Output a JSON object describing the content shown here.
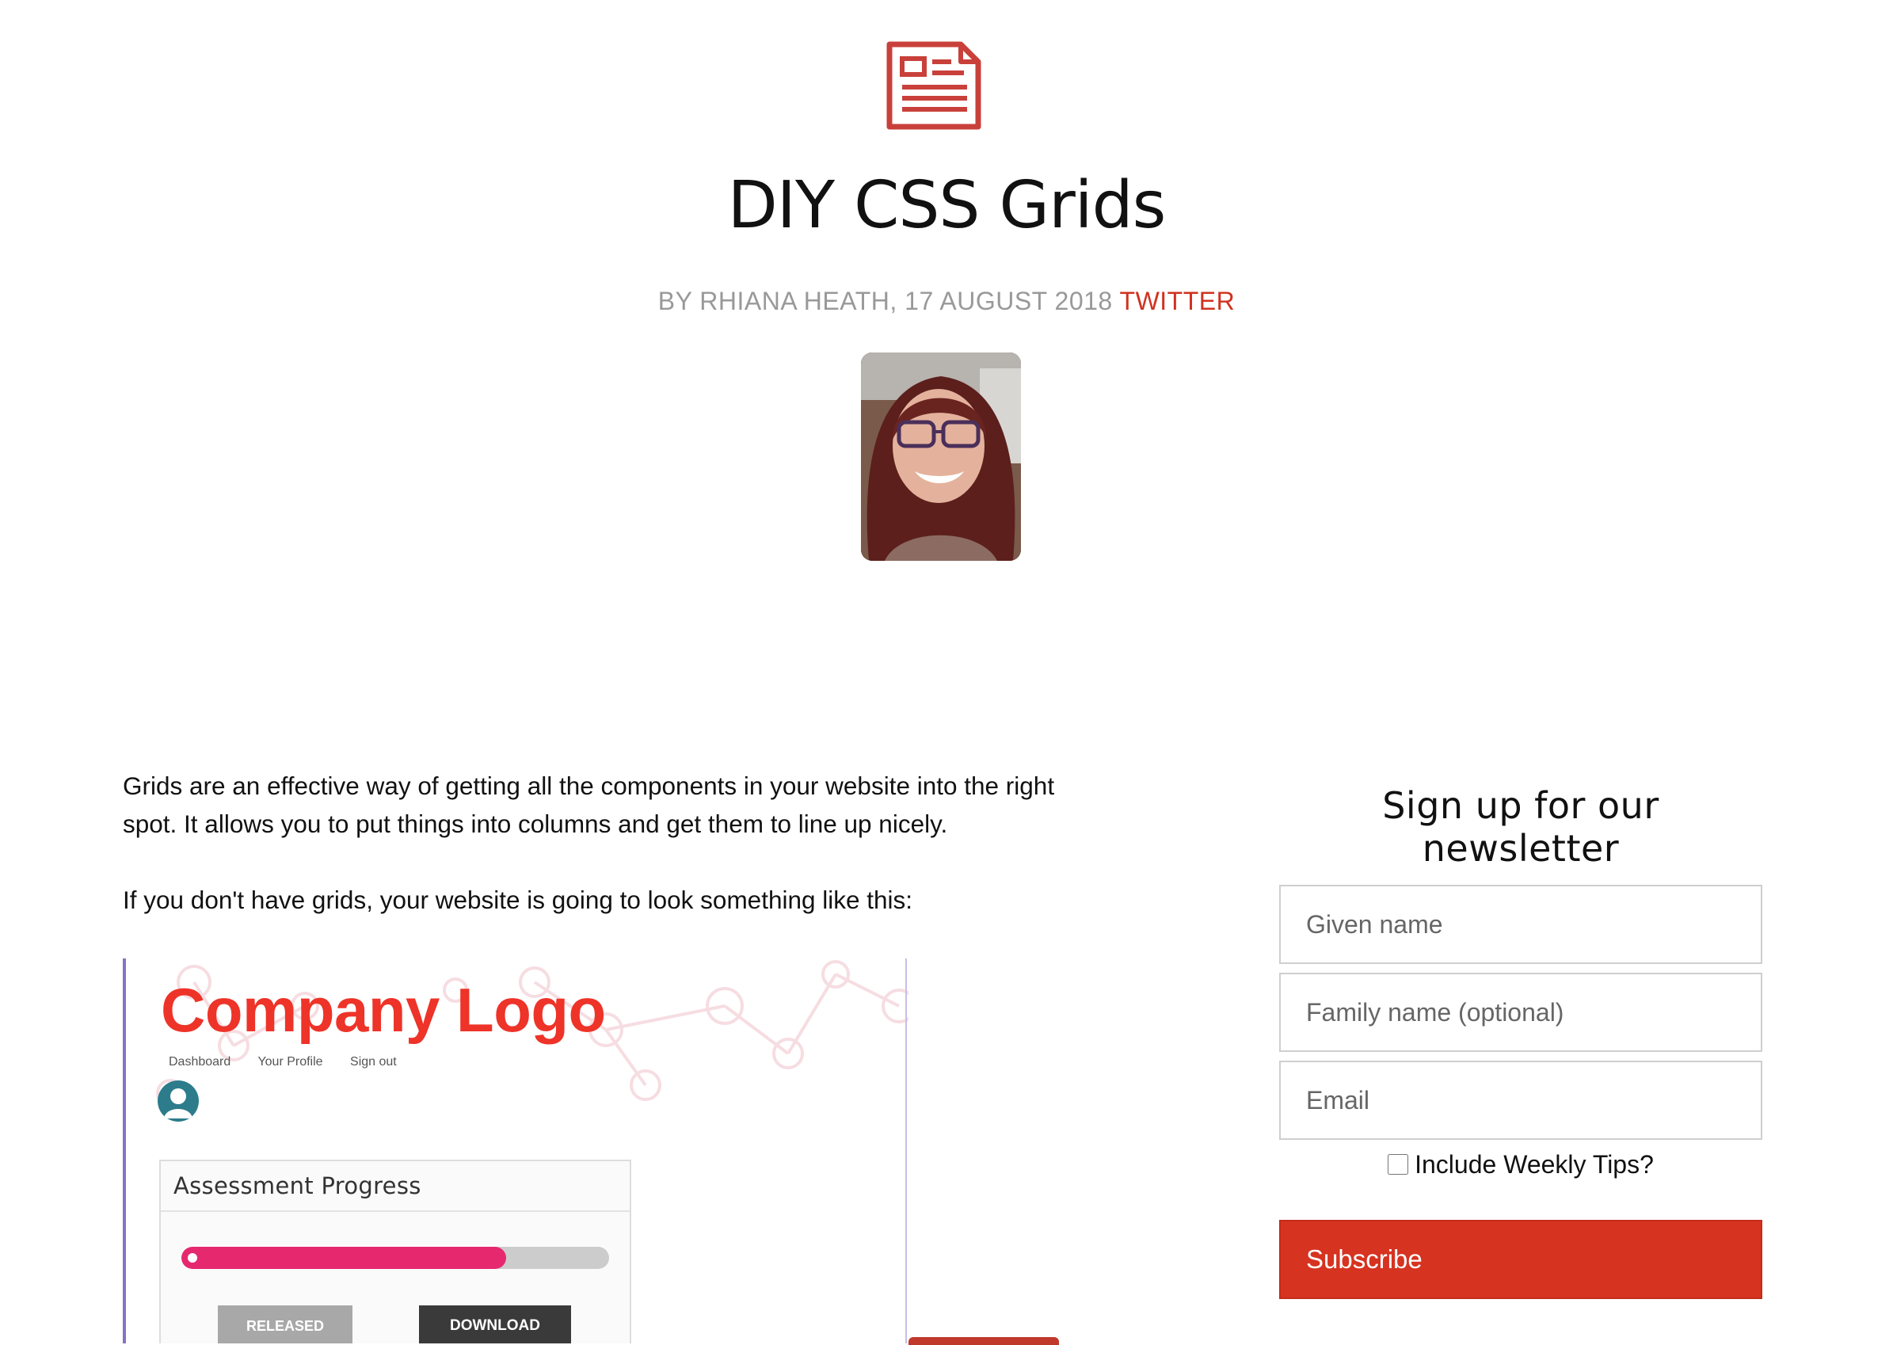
{
  "article": {
    "title": "DIY CSS Grids",
    "byline": "BY RHIANA HEATH, 17 AUGUST 2018",
    "twitter_label": "TWITTER",
    "paragraph_1": "Grids are an effective way of getting all the components in your website into the right spot. It allows you to put things into columns and get them to line up nicely.",
    "paragraph_2": "If you don't have grids, your website is going to look something like this:"
  },
  "figure": {
    "logo_text": "Company Logo",
    "nav": [
      "Dashboard",
      "Your Profile",
      "Sign out"
    ],
    "card_title": "Assessment Progress",
    "progress": 0.76,
    "released_label": "RELEASED",
    "download_label": "DOWNLOAD"
  },
  "newsletter": {
    "heading": "Sign up for our newsletter",
    "given_name_placeholder": "Given name",
    "family_name_placeholder": "Family name (optional)",
    "email_placeholder": "Email",
    "tips_label": "Include Weekly Tips?",
    "subscribe_label": "Subscribe"
  },
  "colors": {
    "accent": "#d63320",
    "link": "#d0311f",
    "logo_red": "#ee3328",
    "progress_pink": "#e6286f"
  },
  "icons": {
    "article": "newspaper-icon",
    "user": "user-avatar-icon"
  }
}
